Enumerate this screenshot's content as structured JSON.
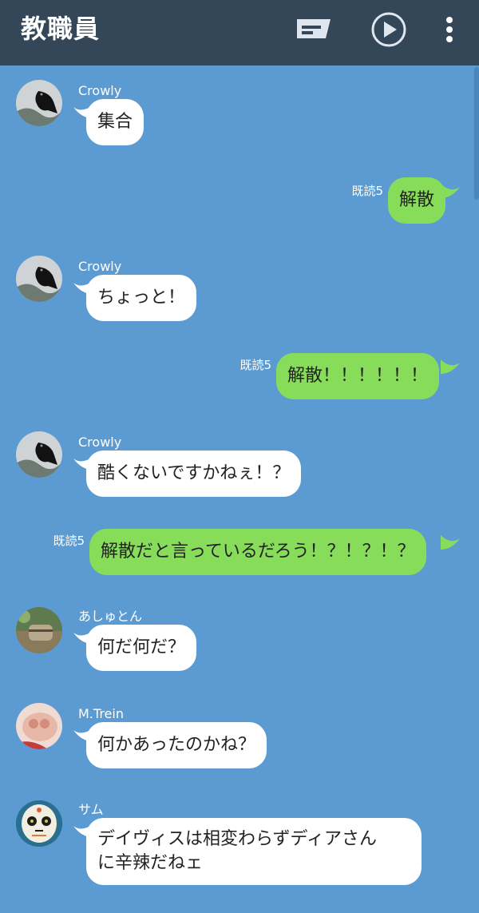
{
  "header": {
    "title": "教職員",
    "icons": [
      "notes-icon",
      "play-icon",
      "more-vert-icon"
    ],
    "background": "#344759"
  },
  "chat": {
    "background": "#5b9bd2",
    "incoming_bubble_color": "#ffffff",
    "outgoing_bubble_color": "#87dd5a",
    "messages": [
      {
        "direction": "in",
        "sender": "Crowly",
        "text": "集合"
      },
      {
        "direction": "out",
        "read_label": "既読5",
        "text": "解散"
      },
      {
        "direction": "in",
        "sender": "Crowly",
        "text": "ちょっと！"
      },
      {
        "direction": "out",
        "read_label": "既読5",
        "text": "解散！！！！！！"
      },
      {
        "direction": "in",
        "sender": "Crowly",
        "text": "酷くないですかねぇ！？"
      },
      {
        "direction": "out",
        "read_label": "既読5",
        "text": "解散だと言っているだろう！？！？！？"
      },
      {
        "direction": "in",
        "sender": "あしゅとん",
        "text": "何だ何だ？"
      },
      {
        "direction": "in",
        "sender": "M.Trein",
        "text": "何かあったのかね？"
      },
      {
        "direction": "in",
        "sender": "サム",
        "text": "デイヴィスは相変わらずディアさん\nに辛辣だねェ"
      }
    ]
  }
}
